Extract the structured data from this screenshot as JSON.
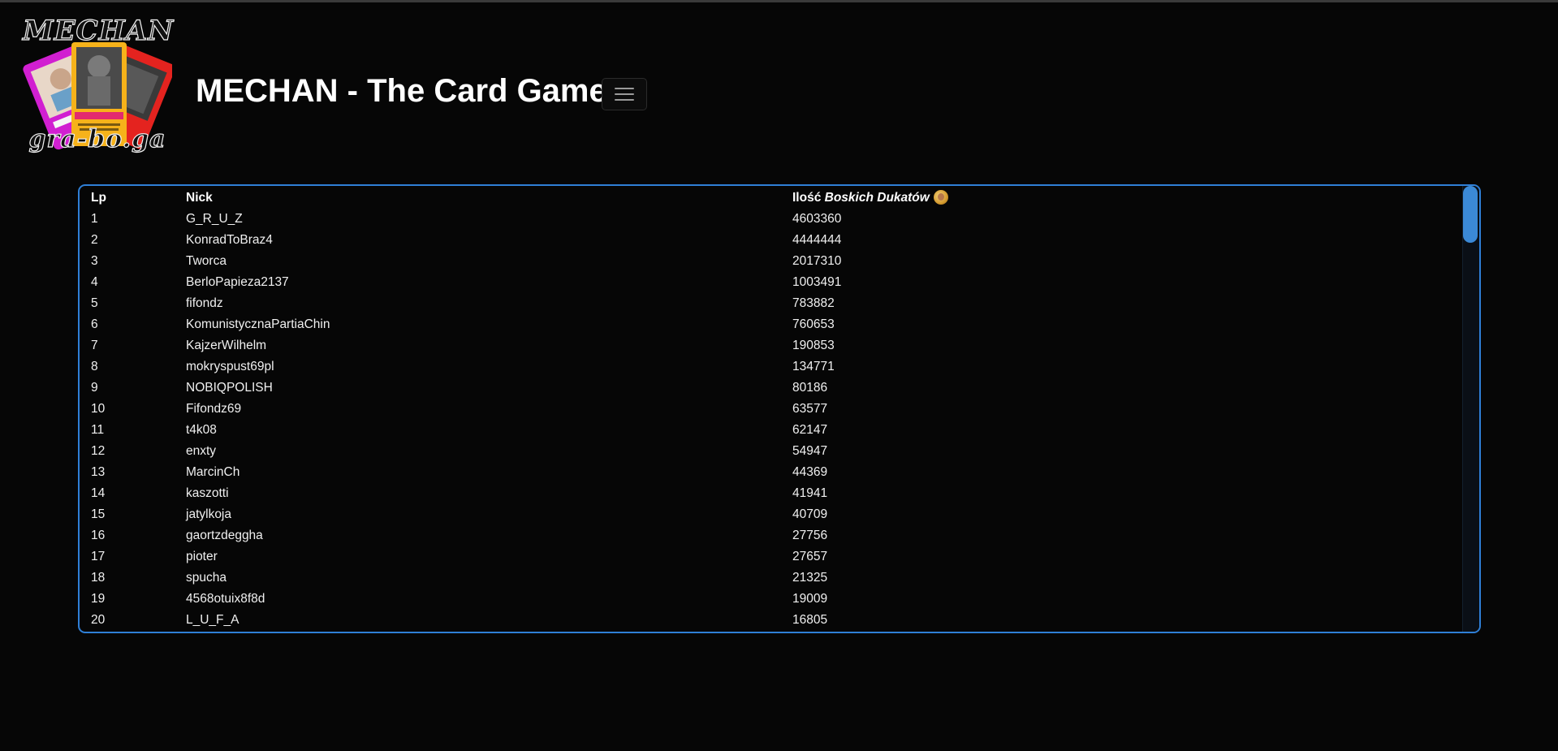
{
  "header": {
    "logo_top_text": "MECHAN",
    "logo_bottom_text": "gra-bo.ga",
    "title": "MECHAN - The Card Game",
    "menu_icon": "hamburger-icon"
  },
  "leaderboard": {
    "columns": {
      "lp": "Lp",
      "nick": "Nick",
      "dukaty_prefix": "Ilość",
      "dukaty_italic": "Boskich Dukatów",
      "dukaty_icon": "coin-icon"
    },
    "rows": [
      {
        "lp": "1",
        "nick": "G_R_U_Z",
        "dukaty": "4603360"
      },
      {
        "lp": "2",
        "nick": "KonradToBraz4",
        "dukaty": "4444444"
      },
      {
        "lp": "3",
        "nick": "Tworca",
        "dukaty": "2017310"
      },
      {
        "lp": "4",
        "nick": "BerloPapieza2137",
        "dukaty": "1003491"
      },
      {
        "lp": "5",
        "nick": "fifondz",
        "dukaty": "783882"
      },
      {
        "lp": "6",
        "nick": "KomunistycznaPartiaChin",
        "dukaty": "760653"
      },
      {
        "lp": "7",
        "nick": "KajzerWilhelm",
        "dukaty": "190853"
      },
      {
        "lp": "8",
        "nick": "mokryspust69pl",
        "dukaty": "134771"
      },
      {
        "lp": "9",
        "nick": "NOBIQPOLISH",
        "dukaty": "80186"
      },
      {
        "lp": "10",
        "nick": "Fifondz69",
        "dukaty": "63577"
      },
      {
        "lp": "11",
        "nick": "t4k08",
        "dukaty": "62147"
      },
      {
        "lp": "12",
        "nick": "enxty",
        "dukaty": "54947"
      },
      {
        "lp": "13",
        "nick": "MarcinCh",
        "dukaty": "44369"
      },
      {
        "lp": "14",
        "nick": "kaszotti",
        "dukaty": "41941"
      },
      {
        "lp": "15",
        "nick": "jatylkoja",
        "dukaty": "40709"
      },
      {
        "lp": "16",
        "nick": "gaortzdeggha",
        "dukaty": "27756"
      },
      {
        "lp": "17",
        "nick": "pioter",
        "dukaty": "27657"
      },
      {
        "lp": "18",
        "nick": "spucha",
        "dukaty": "21325"
      },
      {
        "lp": "19",
        "nick": "4568otuix8f8d",
        "dukaty": "19009"
      },
      {
        "lp": "20",
        "nick": "L_U_F_A",
        "dukaty": "16805"
      }
    ]
  },
  "colors": {
    "background": "#060606",
    "panel_border": "#2f7fd6",
    "scrollbar_thumb": "#3b89d6"
  }
}
